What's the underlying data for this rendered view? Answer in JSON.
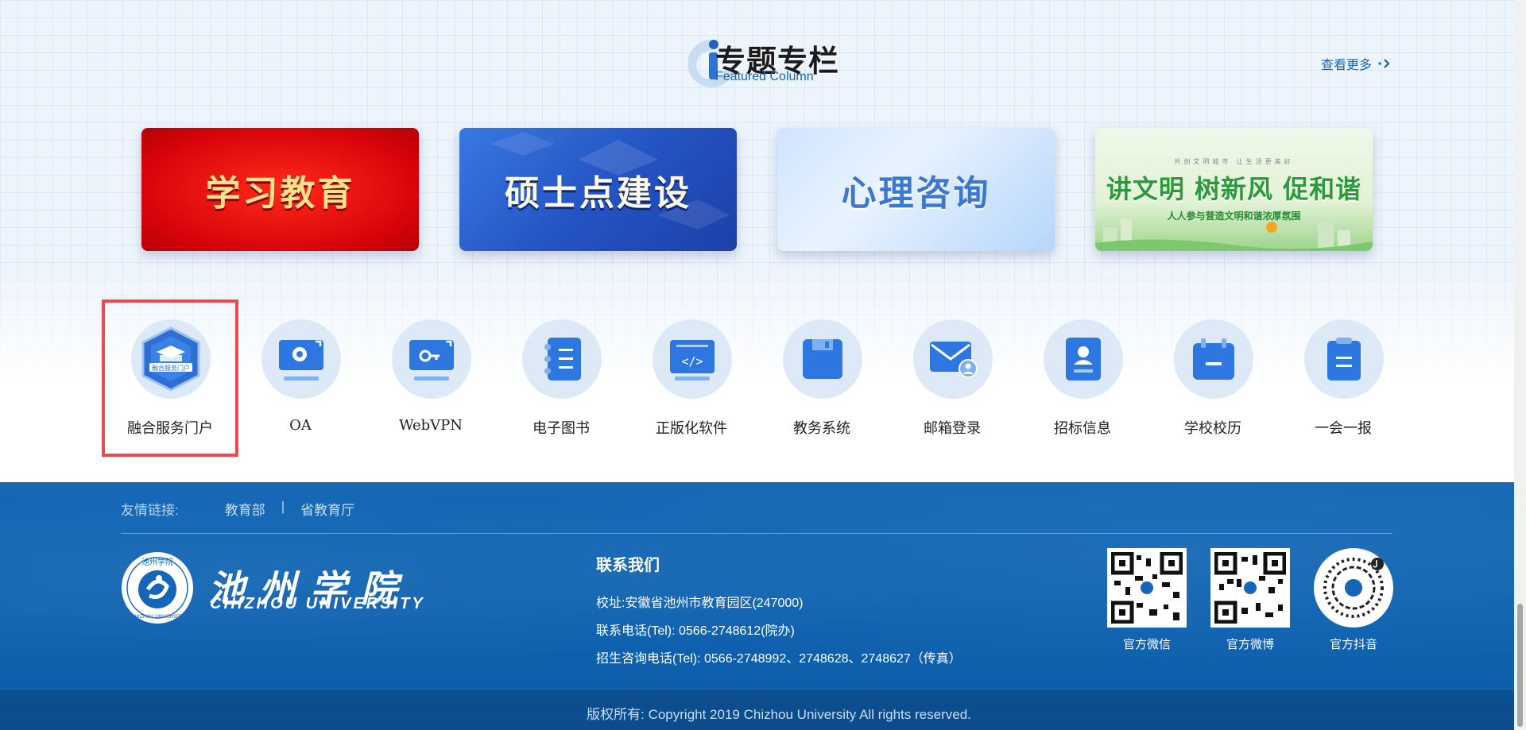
{
  "featured": {
    "title_zh": "专题专栏",
    "title_en": "Featured Column",
    "more_label": "查看更多",
    "banners": [
      {
        "text": "学习教育"
      },
      {
        "text": "硕士点建设"
      },
      {
        "text": "心理咨询"
      },
      {
        "top": "共创文明城市 让生活更美好",
        "text": "讲文明 树新风 促和谐",
        "sub": "人人参与营造文明和谐浓厚氛围"
      }
    ]
  },
  "services": [
    {
      "label": "融合服务门户",
      "icon": "portal-shield-icon",
      "highlighted": true
    },
    {
      "label": "OA",
      "icon": "monitor-search-icon"
    },
    {
      "label": "WebVPN",
      "icon": "monitor-key-icon"
    },
    {
      "label": "电子图书",
      "icon": "notebook-icon"
    },
    {
      "label": "正版化软件",
      "icon": "code-window-icon"
    },
    {
      "label": "教务系统",
      "icon": "floppy-icon"
    },
    {
      "label": "邮箱登录",
      "icon": "mail-user-icon"
    },
    {
      "label": "招标信息",
      "icon": "contact-book-icon"
    },
    {
      "label": "学校校历",
      "icon": "calendar-icon"
    },
    {
      "label": "一会一报",
      "icon": "clipboard-icon"
    }
  ],
  "footer": {
    "links_label": "友情链接:",
    "links": [
      "教育部",
      "省教育厅"
    ],
    "separator": "|",
    "logo_ring_text": "池州学院",
    "logo_bottom_text": "CHIZHOU UNIVERSITY",
    "uni_name_zh": "池州学院",
    "uni_name_en": "CHIZHOU UNIVERSITY",
    "contact_title": "联系我们",
    "address": "校址:安徽省池州市教育园区(247000)",
    "phone": "联系电话(Tel): 0566-2748612(院办)",
    "admission_phone": "招生咨询电话(Tel): 0566-2748992、2748628、2748627（传真）",
    "qr_codes": [
      {
        "label": "官方微信"
      },
      {
        "label": "官方微博"
      },
      {
        "label": "官方抖音"
      }
    ],
    "copyright": "版权所有: Copyright 2019 Chizhou University All rights reserved."
  },
  "colors": {
    "accent_blue": "#1565b8",
    "footer_blue": "#0f62b0",
    "highlight_red": "#f0484d"
  }
}
